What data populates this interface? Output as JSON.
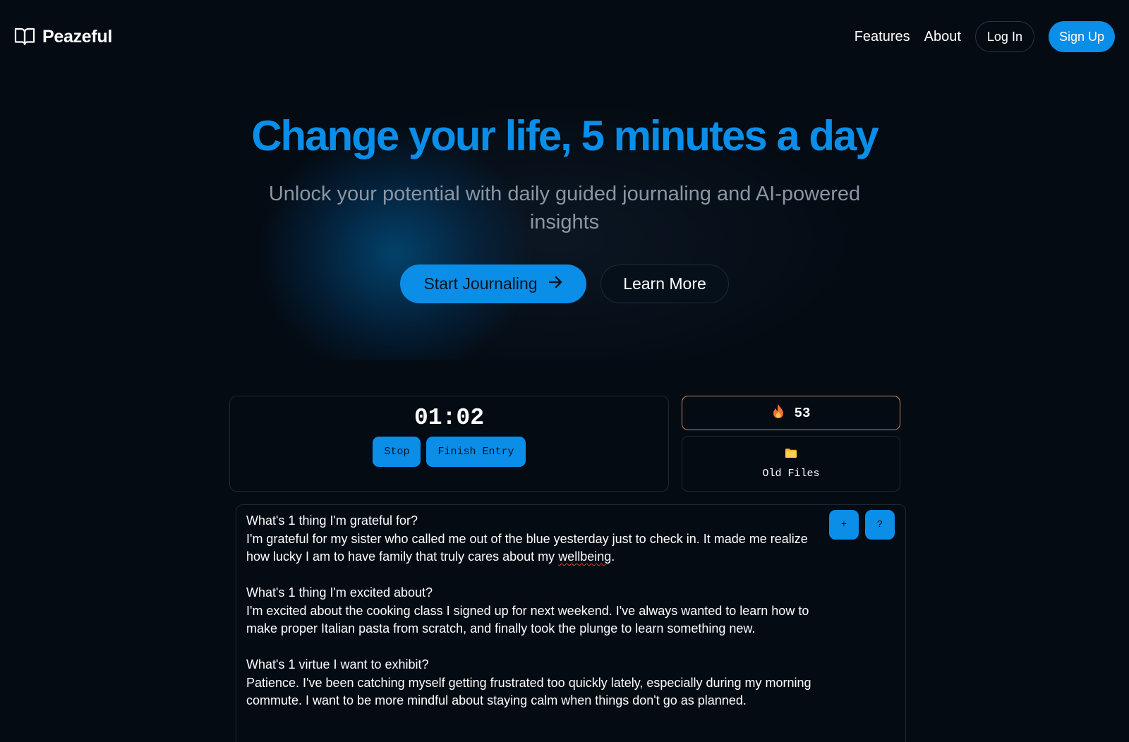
{
  "header": {
    "brand": "Peazeful",
    "nav": {
      "features": "Features",
      "about": "About"
    },
    "login": "Log In",
    "signup": "Sign Up"
  },
  "hero": {
    "title": "Change your life, 5 minutes a day",
    "subtitle": "Unlock your potential with daily guided journaling and AI-powered insights",
    "primary_cta": "Start Journaling",
    "secondary_cta": "Learn More"
  },
  "journal": {
    "timer": "01:02",
    "stop_label": "Stop",
    "finish_label": "Finish Entry",
    "streak": "53",
    "old_files_label": "Old Files",
    "add_label": "+",
    "help_label": "?",
    "entries": [
      {
        "question": "What's 1 thing I'm grateful for?",
        "answer_before": "I'm grateful for my sister who called me out of the blue yesterday just to check in. It made me realize how lucky I am to have family that truly cares about my ",
        "answer_misspelled": "wellbeing",
        "answer_after": "."
      },
      {
        "question": "What's 1 thing I'm excited about?",
        "answer": "I'm excited about the cooking class I signed up for next weekend. I've always wanted to learn how to make proper Italian pasta from scratch, and finally took the plunge to learn something new."
      },
      {
        "question": "What's 1 virtue I want to exhibit?",
        "answer": "Patience. I've been catching myself getting frustrated too quickly lately, especially during my morning commute. I want to be more mindful about staying calm when things don't go as planned."
      }
    ]
  },
  "colors": {
    "accent": "#0a8ee8",
    "background": "#040b13",
    "streak_border": "#c8895a"
  },
  "icons": {
    "brand": "open-book-icon",
    "cta": "arrow-right-icon",
    "streak": "flame-icon",
    "files": "folder-icon"
  }
}
